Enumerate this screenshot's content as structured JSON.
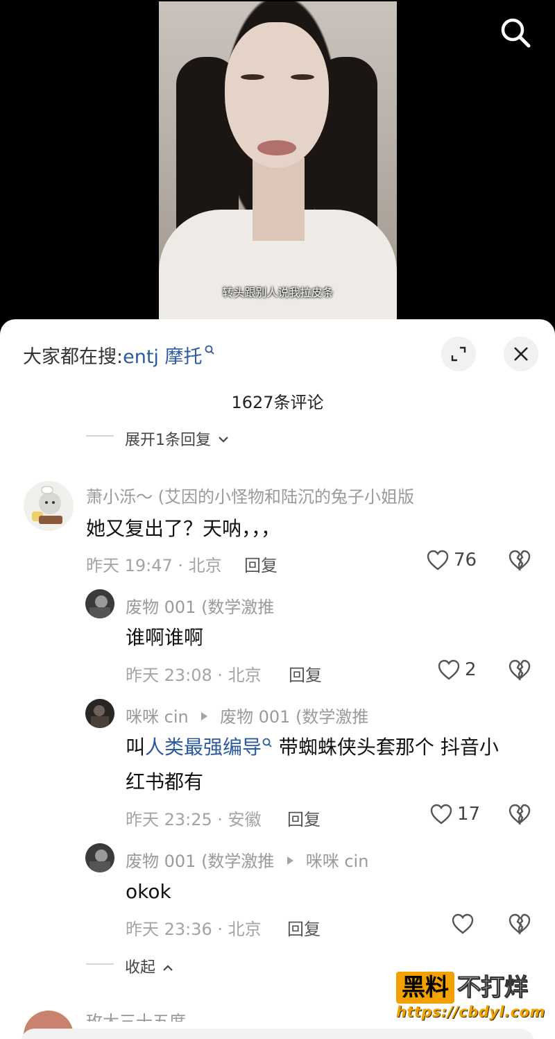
{
  "video": {
    "subtitle": "转头跟别人说我拉皮条"
  },
  "sheet": {
    "hot_search_prefix": "大家都在搜:",
    "hot_search_keyword": "entj 摩托",
    "comment_count": "1627条评论",
    "expand_top": "展开1条回复",
    "collapse": "收起"
  },
  "comments": [
    {
      "user": "萧小泺～ (艾因的小怪物和陆沉的兔子小姐版",
      "text": "她又复出了？天呐，，，",
      "time_location": "昨天 19:47 · 北京",
      "reply": "回复",
      "likes": "76"
    }
  ],
  "replies": [
    {
      "user": "废物 001 (数学激推",
      "text": "谁啊谁啊",
      "time_location": "昨天 23:08 · 北京",
      "reply": "回复",
      "likes": "2"
    },
    {
      "user": "咪咪 cin",
      "reply_to": "废物 001 (数学激推",
      "text_prefix": "叫",
      "text_link": "人类最强编导",
      "text_suffix": " 带蜘蛛侠头套那个 抖音小",
      "text_line2": "红书都有",
      "time_location": "昨天 23:25 · 安徽",
      "reply": "回复",
      "likes": "17"
    },
    {
      "user": "废物 001 (数学激推",
      "reply_to": "咪咪 cin",
      "text": "okok",
      "time_location": "昨天 23:36 · 北京",
      "reply": "回复",
      "likes": ""
    }
  ],
  "next_comment_user_partial": "玫大三十五度",
  "watermark": {
    "box": "黑料",
    "text": "不打烊",
    "url": "https://cbdyl.com"
  },
  "colors": {
    "link": "#2c5a9e",
    "watermark_orange": "#f3a100"
  }
}
